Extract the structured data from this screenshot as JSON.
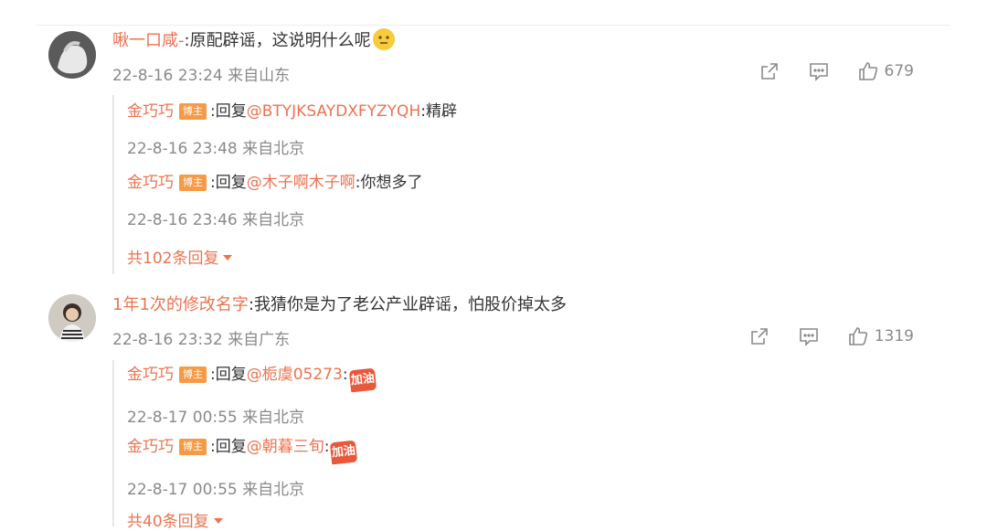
{
  "comments": [
    {
      "author": "啾一口咸-",
      "text": ":原配辟谣，这说明什么呢",
      "time": "22-8-16 23:24 来自山东",
      "likes": "679",
      "replies": [
        {
          "author": "金巧巧",
          "badge": "博主",
          "prefix": ":回复",
          "mention": "@BTYJKSAYDXFYZYQH",
          "text": ":精辟",
          "time": "22-8-16 23:48 来自北京"
        },
        {
          "author": "金巧巧",
          "badge": "博主",
          "prefix": ":回复",
          "mention": "@木子啊木子啊",
          "text": ":你想多了",
          "time": "22-8-16 23:46 来自北京"
        }
      ],
      "more": "共102条回复"
    },
    {
      "author": "1年1次的修改名字",
      "text": ":我猜你是为了老公产业辟谣，怕股价掉太多",
      "time": "22-8-16 23:32 来自广东",
      "likes": "1319",
      "replies": [
        {
          "author": "金巧巧",
          "badge": "博主",
          "prefix": ":回复",
          "mention": "@栀虞05273",
          "text": ":",
          "sticker": "加油",
          "time": "22-8-17 00:55 来自北京"
        },
        {
          "author": "金巧巧",
          "badge": "博主",
          "prefix": ":回复",
          "mention": "@朝暮三旬",
          "text": ":",
          "sticker": "加油",
          "time": "22-8-17 00:55 来自北京"
        }
      ],
      "more": "共40条回复"
    }
  ],
  "icons": {
    "share": "share-icon",
    "comment": "comment-icon",
    "like": "thumbs-up-icon",
    "emoji": "smiley-emoji-icon"
  },
  "colors": {
    "accent": "#eb7350",
    "muted": "#8a8a8a",
    "badge": "#f79a46"
  }
}
